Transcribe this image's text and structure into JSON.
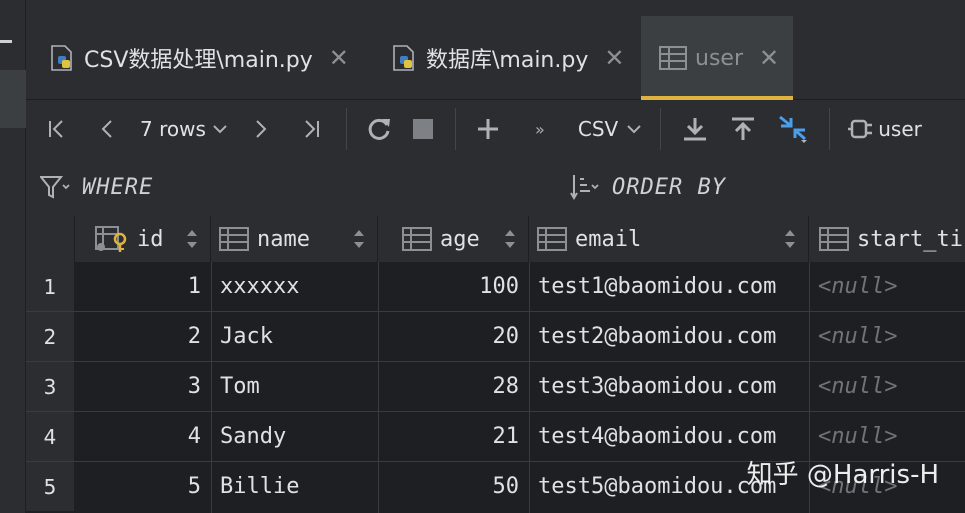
{
  "tabs": [
    {
      "label": "CSV数据处理\\main.py",
      "icon": "python-file-icon",
      "active": false
    },
    {
      "label": "数据库\\main.py",
      "icon": "python-file-icon",
      "active": false
    },
    {
      "label": "user",
      "icon": "table-icon",
      "active": true
    }
  ],
  "toolbar": {
    "rows_label": "7 rows",
    "format_label": "CSV",
    "user_label": "user"
  },
  "filter": {
    "where_label": "WHERE",
    "order_label": "ORDER BY"
  },
  "table": {
    "columns": [
      "id",
      "name",
      "age",
      "email",
      "start_ti"
    ],
    "rows": [
      {
        "n": "1",
        "id": "1",
        "name": "xxxxxx",
        "age": "100",
        "email": "test1@baomidou.com",
        "start": "<null>"
      },
      {
        "n": "2",
        "id": "2",
        "name": "Jack",
        "age": "20",
        "email": "test2@baomidou.com",
        "start": "<null>"
      },
      {
        "n": "3",
        "id": "3",
        "name": "Tom",
        "age": "28",
        "email": "test3@baomidou.com",
        "start": "<null>"
      },
      {
        "n": "4",
        "id": "4",
        "name": "Sandy",
        "age": "21",
        "email": "test4@baomidou.com",
        "start": "<null>"
      },
      {
        "n": "5",
        "id": "5",
        "name": "Billie",
        "age": "50",
        "email": "test5@baomidou.com",
        "start": "<null>"
      }
    ]
  },
  "watermark": "知乎 @Harris-H",
  "colors": {
    "accent": "#e0b23f",
    "background": "#1e1f22",
    "null_text": "#6f737a"
  }
}
